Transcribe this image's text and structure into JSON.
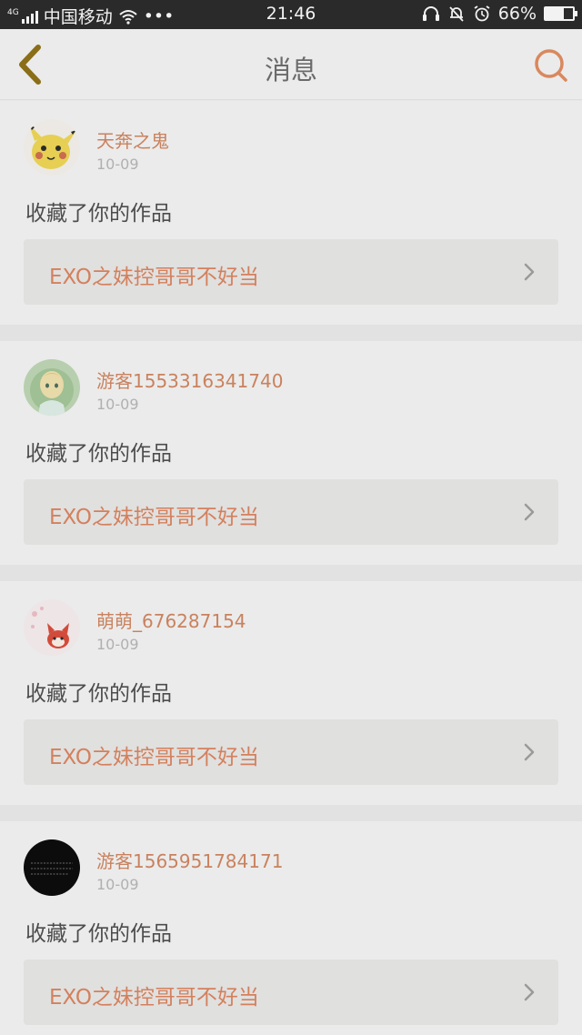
{
  "status_bar": {
    "network_type": "4G",
    "carrier": "中国移动",
    "more_dots": "•••",
    "time": "21:46",
    "battery_percent": "66%",
    "battery_level": 0.66
  },
  "navbar": {
    "title": "消息",
    "back_icon": "chevron-left-icon",
    "search_icon": "search-icon"
  },
  "messages": [
    {
      "username": "天奔之鬼",
      "date": "10-09",
      "action": "收藏了你的作品",
      "work_title": "EXO之妹控哥哥不好当",
      "avatar": "pikachu-avatar"
    },
    {
      "username": "游客1553316341740",
      "date": "10-09",
      "action": "收藏了你的作品",
      "work_title": "EXO之妹控哥哥不好当",
      "avatar": "anime-girl-avatar"
    },
    {
      "username": "萌萌_676287154",
      "date": "10-09",
      "action": "收藏了你的作品",
      "work_title": "EXO之妹控哥哥不好当",
      "avatar": "red-fox-avatar"
    },
    {
      "username": "游客1565951784171",
      "date": "10-09",
      "action": "收藏了你的作品",
      "work_title": "EXO之妹控哥哥不好当",
      "avatar": "black-text-avatar"
    }
  ],
  "colors": {
    "accent": "#d4805c",
    "back_icon": "#8a6e18",
    "search_icon": "#d9885e"
  }
}
